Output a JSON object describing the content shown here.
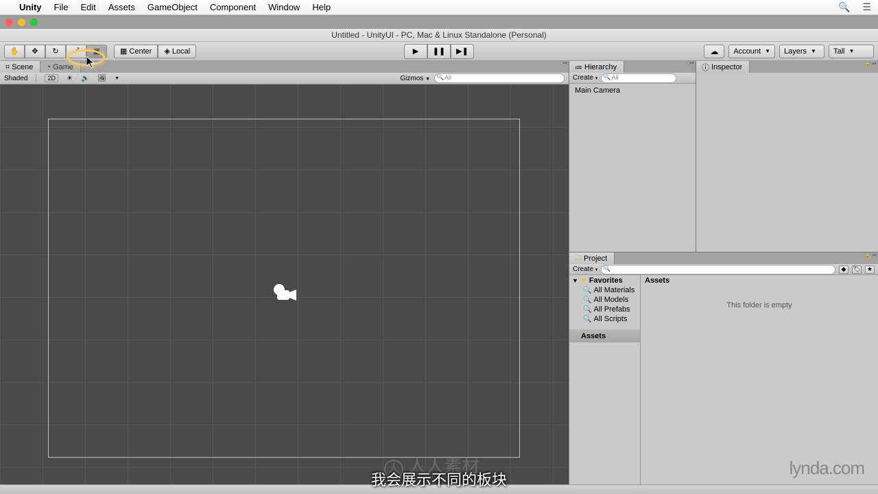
{
  "menubar": {
    "app": "Unity",
    "items": [
      "File",
      "Edit",
      "Assets",
      "GameObject",
      "Component",
      "Window",
      "Help"
    ]
  },
  "window_title": "Untitled - UnityUI - PC, Mac & Linux Standalone (Personal)",
  "toolbar": {
    "pivot": "Center",
    "space": "Local",
    "account": "Account",
    "layers": "Layers",
    "layout": "Tall"
  },
  "scene": {
    "tab_scene": "Scene",
    "tab_game": "Game",
    "shading": "Shaded",
    "gizmos": "Gizmos",
    "search_placeholder": "All"
  },
  "hierarchy": {
    "title": "Hierarchy",
    "create": "Create",
    "search_placeholder": "All",
    "items": [
      "Main Camera"
    ]
  },
  "inspector": {
    "title": "Inspector"
  },
  "project": {
    "title": "Project",
    "create": "Create",
    "favorites": "Favorites",
    "fav_items": [
      "All Materials",
      "All Models",
      "All Prefabs",
      "All Scripts"
    ],
    "assets": "Assets",
    "content_header": "Assets",
    "empty_msg": "This folder is empty"
  },
  "overlays": {
    "watermark1": "人人素材",
    "watermark2": "lynda.com",
    "subtitle": "我会展示不同的板块"
  }
}
